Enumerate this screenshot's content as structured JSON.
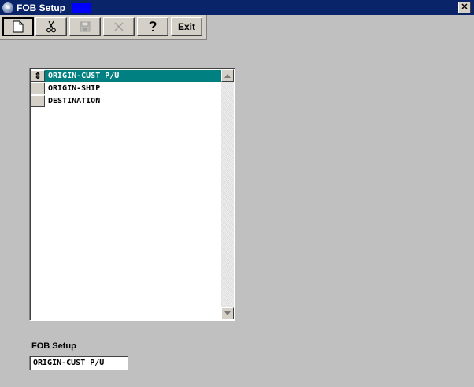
{
  "window": {
    "title": "FOB Setup",
    "close_glyph": "✕",
    "icon": "app-globe-icon"
  },
  "toolbar": {
    "buttons": [
      {
        "name": "new-button",
        "icon": "new-document-icon",
        "enabled": true
      },
      {
        "name": "cut-button",
        "icon": "scissors-icon",
        "enabled": true
      },
      {
        "name": "save-button",
        "icon": "floppy-disk-icon",
        "enabled": false
      },
      {
        "name": "delete-button",
        "icon": "x-icon",
        "enabled": false
      },
      {
        "name": "help-button",
        "icon": "question-mark-icon",
        "enabled": true
      },
      {
        "name": "exit-button",
        "label": "Exit",
        "enabled": true
      }
    ],
    "exit_label": "Exit"
  },
  "list": {
    "rows": [
      {
        "label": "ORIGIN-CUST P/U",
        "selected": true,
        "marker": "⇕"
      },
      {
        "label": "ORIGIN-SHIP",
        "selected": false,
        "marker": ""
      },
      {
        "label": "DESTINATION",
        "selected": false,
        "marker": ""
      }
    ]
  },
  "detail": {
    "label": "FOB Setup",
    "value": "ORIGIN-CUST P/U"
  },
  "colors": {
    "title_bar": "#0a246a",
    "selection": "#008080",
    "face": "#d4d0c8",
    "background": "#c0c0c0"
  }
}
